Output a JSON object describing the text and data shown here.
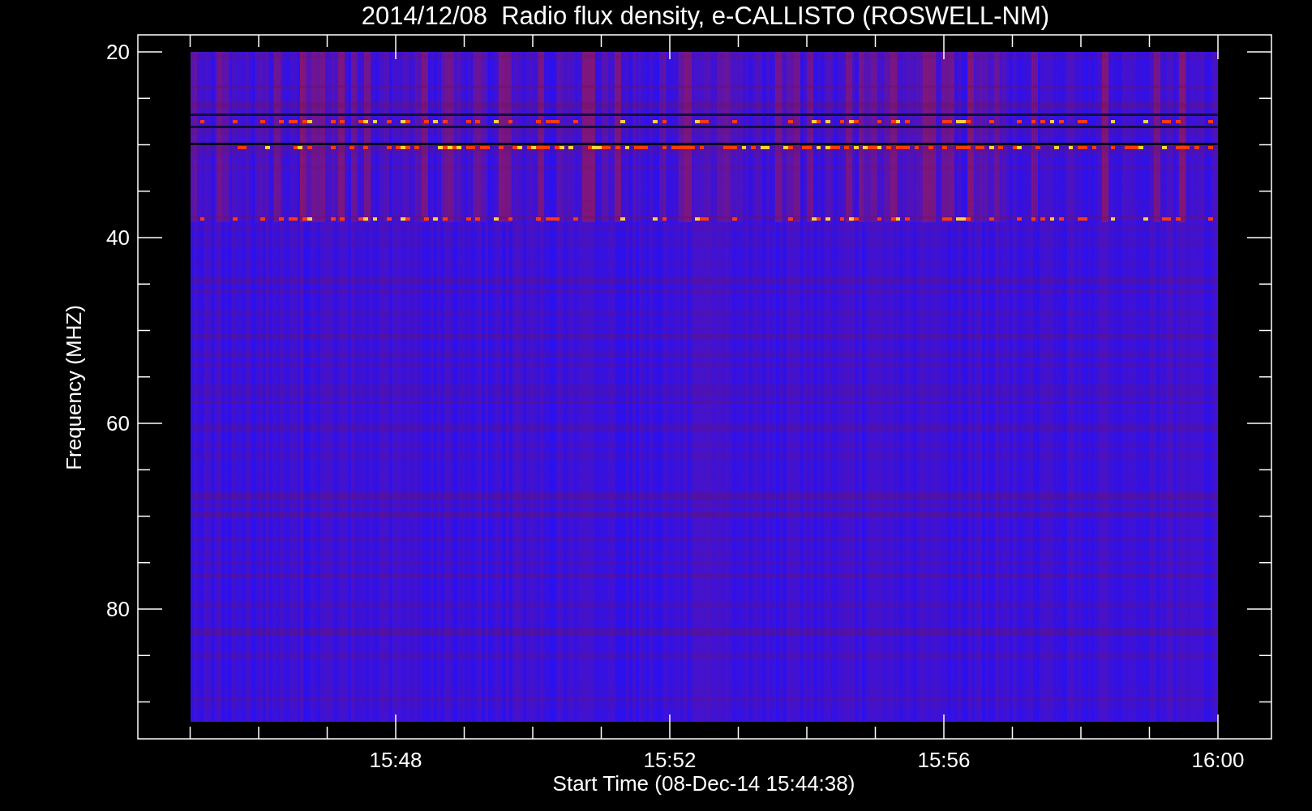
{
  "title": "2014/12/08  Radio flux density, e-CALLISTO (ROSWELL-NM)",
  "plot": {
    "ylabel": "Frequency (MHZ)",
    "yticks": [
      "20",
      "40",
      "60",
      "80"
    ],
    "xticks": [
      "15:48",
      "15:52",
      "15:56",
      "16:00"
    ],
    "xlabel": "Start Time (08-Dec-14 15:44:38)"
  }
}
